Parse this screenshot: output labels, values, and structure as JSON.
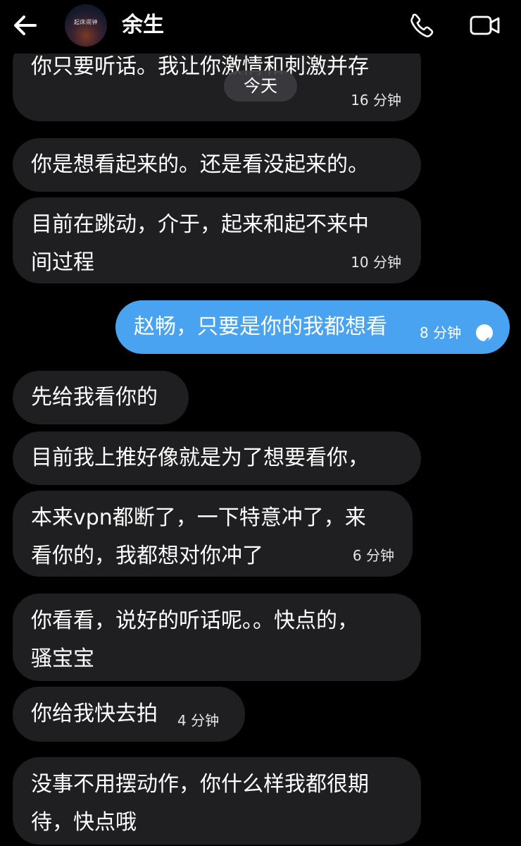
{
  "header": {
    "contact_name": "余生",
    "avatar_text": "起床闹钟"
  },
  "date_divider": "今天",
  "messages": [
    {
      "lines": [
        "你只要听话。我让你激情和刺激并存"
      ],
      "time": "16 分钟",
      "direction": "received"
    },
    {
      "lines": [
        "你是想看起来的。还是看没起来的。"
      ],
      "time": "",
      "direction": "received"
    },
    {
      "lines": [
        "目前在跳动，介于，起来和起不来中",
        "间过程"
      ],
      "time": "10 分钟",
      "direction": "received"
    },
    {
      "lines": [
        "赵畅，只要是你的我都想看"
      ],
      "time": "8 分钟",
      "direction": "sent",
      "status": "read"
    },
    {
      "lines": [
        "先给我看你的"
      ],
      "time": "",
      "direction": "received"
    },
    {
      "lines": [
        "目前我上推好像就是为了想要看你，"
      ],
      "time": "",
      "direction": "received"
    },
    {
      "lines": [
        "本来vpn都断了，一下特意冲了，来",
        "看你的，我都想对你冲了"
      ],
      "time": "6 分钟",
      "direction": "received"
    },
    {
      "lines": [
        "你看看，说好的听话呢。。快点的，",
        "骚宝宝"
      ],
      "time": "",
      "direction": "received"
    },
    {
      "lines": [
        "你给我快去拍"
      ],
      "time": "4 分钟",
      "direction": "received"
    },
    {
      "lines": [
        "没事不用摆动作，你什么样我都很期",
        "待，快点哦"
      ],
      "time": "",
      "direction": "received"
    }
  ],
  "colors": {
    "background": "#000000",
    "received_bubble": "#1f1f21",
    "sent_bubble": "#4aa3f0"
  },
  "icons": [
    "back-arrow-icon",
    "phone-icon",
    "video-camera-icon",
    "read-check-icon"
  ]
}
